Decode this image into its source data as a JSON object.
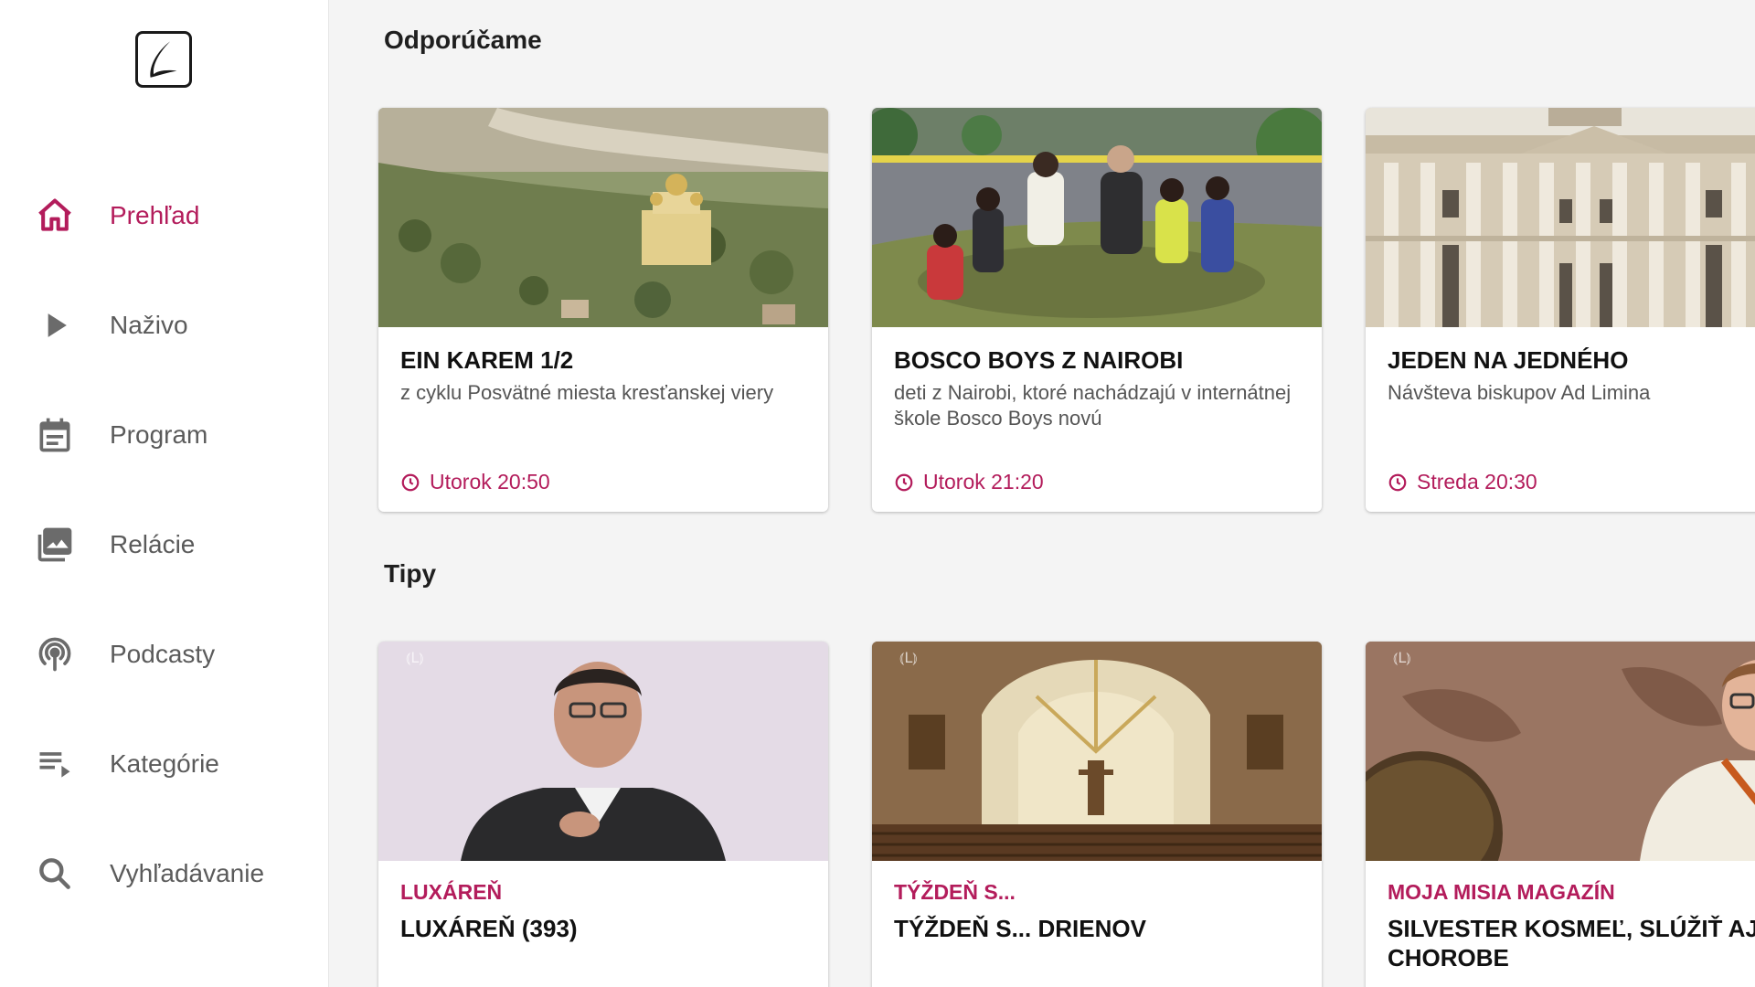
{
  "app": {
    "logo_icon": "lux-logo-icon"
  },
  "sidebar": {
    "items": [
      {
        "label": "Prehľad",
        "icon": "home-icon",
        "active": true
      },
      {
        "label": "Naživo",
        "icon": "play-icon",
        "active": false
      },
      {
        "label": "Program",
        "icon": "calendar-icon",
        "active": false
      },
      {
        "label": "Relácie",
        "icon": "photo-library-icon",
        "active": false
      },
      {
        "label": "Podcasty",
        "icon": "podcast-icon",
        "active": false
      },
      {
        "label": "Kategórie",
        "icon": "playlist-icon",
        "active": false
      },
      {
        "label": "Vyhľadávanie",
        "icon": "search-icon",
        "active": false
      }
    ]
  },
  "colors": {
    "accent": "#b31c5b",
    "background": "#f4f4f4",
    "sidebar": "#ffffff"
  },
  "recommended": {
    "title": "Odporúčame",
    "cards": [
      {
        "title": "EIN KAREM 1/2",
        "description": "z cyklu Posvätné miesta kresťanskej viery",
        "time": "Utorok 20:50",
        "thumb": "landscape-monastery"
      },
      {
        "title": "BOSCO BOYS Z NAIROBI",
        "description": "deti z Nairobi, ktoré nachádzajú v internátnej škole Bosco Boys novú",
        "time": "Utorok 21:20",
        "thumb": "group-of-boys"
      },
      {
        "title": "JEDEN NA JEDNÉHO",
        "description": "Návšteva biskupov Ad Limina",
        "time": "Streda 20:30",
        "thumb": "basilica-facade"
      }
    ]
  },
  "tips": {
    "title": "Tipy",
    "cards": [
      {
        "series": "LUXÁREŇ",
        "episode": "LUXÁREŇ (393)",
        "thumb": "priest-interview"
      },
      {
        "series": "TÝŽDEŇ S...",
        "episode": "TÝŽDEŇ S... DRIENOV",
        "thumb": "church-interior"
      },
      {
        "series": "MOJA MISIA MAGAZÍN",
        "episode": "SILVESTER KOSMEĽ, SLÚŽIŤ AJ V CHOROBE",
        "thumb": "man-with-globe"
      }
    ]
  }
}
